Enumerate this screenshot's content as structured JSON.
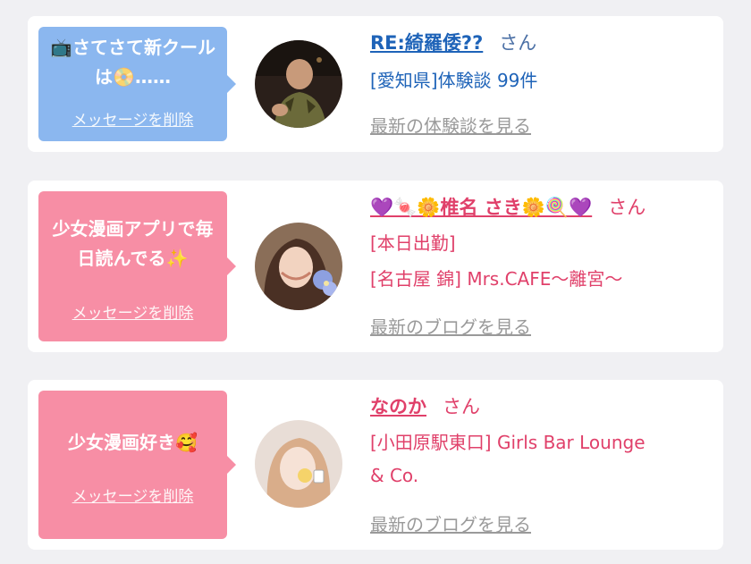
{
  "cards": [
    {
      "bubble_message": "📺さてさて新クールは📀……",
      "delete_label": "メッセージを削除",
      "name": "RE:綺羅倭??",
      "honorific": "さん",
      "details": [
        "[愛知県]体験談 99件"
      ],
      "latest_link": "最新の体験談を見る",
      "bubble_color": "#8bb7ef",
      "name_color": "#1e63b8"
    },
    {
      "bubble_message": "少女漫画アプリで毎日読んでる✨",
      "delete_label": "メッセージを削除",
      "name": "💜🍬🌼椎名 さき🌼🍭💜",
      "honorific": "さん",
      "details": [
        "[本日出勤]",
        "[名古屋 錦] Mrs.CAFE〜離宮〜"
      ],
      "latest_link": "最新のブログを見る",
      "bubble_color": "#f78ea5",
      "name_color": "#e0406a"
    },
    {
      "bubble_message": "少女漫画好き🥰",
      "delete_label": "メッセージを削除",
      "name": "なのか",
      "honorific": "さん",
      "details": [
        "[小田原駅東口] Girls Bar Lounge",
        "& Co."
      ],
      "latest_link": "最新のブログを見る",
      "bubble_color": "#f78ea5",
      "name_color": "#e0406a"
    }
  ]
}
